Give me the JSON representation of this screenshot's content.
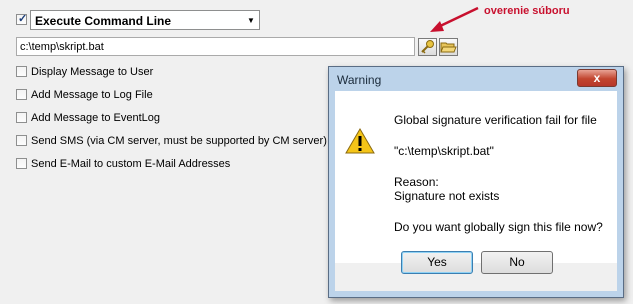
{
  "action": {
    "enabled": true,
    "selected": "Execute Command Line"
  },
  "command": {
    "value": "c:\\temp\\skript.bat"
  },
  "icons": {
    "sign": "key-icon",
    "browse": "folder-open-icon"
  },
  "annotation": {
    "text": "overenie súboru",
    "color": "#c8102e"
  },
  "options": [
    {
      "label": "Display Message to User",
      "checked": false
    },
    {
      "label": "Add Message to Log File",
      "checked": false
    },
    {
      "label": "Add Message to EventLog",
      "checked": false
    },
    {
      "label": "Send SMS (via CM server, must be supported by CM server)",
      "checked": false
    },
    {
      "label": "Send E-Mail to custom E-Mail Addresses",
      "checked": false
    }
  ],
  "dialog": {
    "title": "Warning",
    "close_label": "x",
    "icon": "warning-icon",
    "message": "Global signature verification fail for file",
    "file": "\"c:\\temp\\skript.bat\"",
    "reason_label": "Reason:",
    "reason": "Signature not exists",
    "question": "Do you want globally sign this file now?",
    "yes_label": "Yes",
    "no_label": "No"
  }
}
